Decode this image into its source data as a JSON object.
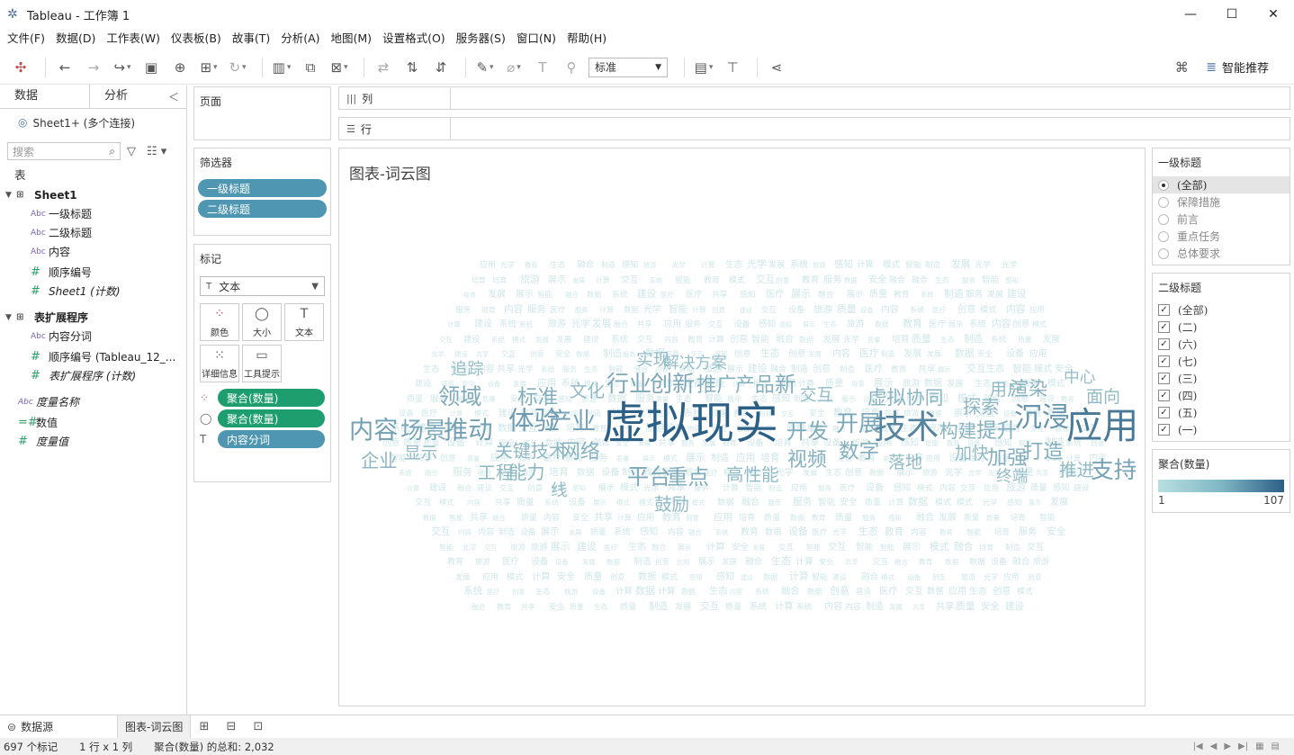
{
  "window": {
    "title": "Tableau - 工作簿 1",
    "min": "—",
    "max": "☐",
    "close": "✕"
  },
  "menus": [
    "文件(F)",
    "数据(D)",
    "工作表(W)",
    "仪表板(B)",
    "故事(T)",
    "分析(A)",
    "地图(M)",
    "设置格式(O)",
    "服务器(S)",
    "窗口(N)",
    "帮助(H)"
  ],
  "toolbar": {
    "fit_select": "标准",
    "smart_label": "智能推荐"
  },
  "left": {
    "tab_data": "数据",
    "tab_analysis": "分析",
    "datasource": "Sheet1+ (多个连接)",
    "search_placeholder": "搜索",
    "tables_header": "表",
    "sheet1": "Sheet1",
    "sheet1_fields": [
      {
        "type": "Abc",
        "name": "一级标题"
      },
      {
        "type": "Abc",
        "name": "二级标题"
      },
      {
        "type": "Abc",
        "name": "内容"
      },
      {
        "type": "#",
        "name": "顺序编号"
      },
      {
        "type": "#",
        "name": "Sheet1 (计数)"
      }
    ],
    "ext_table": "表扩展程序",
    "ext_fields": [
      {
        "type": "Abc",
        "name": "内容分词"
      },
      {
        "type": "#",
        "name": "顺序编号 (Tableau_12_..."
      },
      {
        "type": "#",
        "name": "表扩展程序 (计数)"
      }
    ],
    "measure_names": "度量名称",
    "measures": "数值",
    "measure_values": "度量值"
  },
  "shelves": {
    "pages": "页面",
    "filters": "筛选器",
    "filter_pills": [
      "一级标题",
      "二级标题"
    ],
    "marks": "标记",
    "mark_type": "文本",
    "mark_buttons": [
      "颜色",
      "大小",
      "文本",
      "详细信息",
      "工具提示"
    ],
    "encodings": [
      "聚合(数量)",
      "聚合(数量)",
      "内容分词"
    ],
    "columns": "列",
    "rows": "行"
  },
  "viz": {
    "title": "图表-词云图",
    "words": [
      {
        "t": "虚拟现实",
        "v": 107
      },
      {
        "t": "应用",
        "v": 78
      },
      {
        "t": "技术",
        "v": 66
      },
      {
        "t": "沉浸",
        "v": 50
      },
      {
        "t": "体验",
        "v": 44
      },
      {
        "t": "内容",
        "v": 40
      },
      {
        "t": "场景",
        "v": 36
      },
      {
        "t": "推动",
        "v": 40
      },
      {
        "t": "产业",
        "v": 38
      },
      {
        "t": "行业",
        "v": 34
      },
      {
        "t": "创新",
        "v": 34
      },
      {
        "t": "领域",
        "v": 32
      },
      {
        "t": "开展",
        "v": 34
      },
      {
        "t": "支持",
        "v": 36
      },
      {
        "t": "平台",
        "v": 32
      },
      {
        "t": "重点",
        "v": 30
      },
      {
        "t": "数字",
        "v": 28
      },
      {
        "t": "开发",
        "v": 30
      },
      {
        "t": "标准",
        "v": 28
      },
      {
        "t": "推广",
        "v": 27
      },
      {
        "t": "产品",
        "v": 26
      },
      {
        "t": "新",
        "v": 30
      },
      {
        "t": "提升",
        "v": 28
      },
      {
        "t": "打造",
        "v": 27
      },
      {
        "t": "加强",
        "v": 27
      },
      {
        "t": "网络",
        "v": 26
      },
      {
        "t": "视频",
        "v": 26
      },
      {
        "t": "虚拟",
        "v": 25
      },
      {
        "t": "渲染",
        "v": 24
      },
      {
        "t": "协同",
        "v": 23
      },
      {
        "t": "构建",
        "v": 23
      },
      {
        "t": "探索",
        "v": 22
      },
      {
        "t": "企业",
        "v": 22
      },
      {
        "t": "能力",
        "v": 22
      },
      {
        "t": "工程",
        "v": 21
      },
      {
        "t": "关键技术",
        "v": 21
      },
      {
        "t": "文化",
        "v": 20
      },
      {
        "t": "高性能",
        "v": 20
      },
      {
        "t": "鼓励",
        "v": 20
      },
      {
        "t": "用户",
        "v": 19
      },
      {
        "t": "面向",
        "v": 19
      },
      {
        "t": "推进",
        "v": 20
      },
      {
        "t": "加快",
        "v": 19
      },
      {
        "t": "落地",
        "v": 19
      },
      {
        "t": "显示",
        "v": 18
      },
      {
        "t": "实现",
        "v": 18
      },
      {
        "t": "解决方案",
        "v": 16
      },
      {
        "t": "交互",
        "v": 18
      },
      {
        "t": "追踪",
        "v": 17
      },
      {
        "t": "线",
        "v": 18
      },
      {
        "t": "中心",
        "v": 16
      },
      {
        "t": "终端",
        "v": 16
      }
    ]
  },
  "right": {
    "level1": "一级标题",
    "level1_opts": [
      "(全部)",
      "保障措施",
      "前言",
      "重点任务",
      "总体要求"
    ],
    "level2": "二级标题",
    "level2_opts": [
      "(全部)",
      "(二)",
      "(六)",
      "(七)",
      "(三)",
      "(四)",
      "(五)",
      "(一)"
    ],
    "legend_title": "聚合(数量)",
    "legend_min": "1",
    "legend_max": "107",
    "legend_colors": [
      "#b9dfe0",
      "#2c5f86"
    ]
  },
  "bottom": {
    "datasource_tab": "数据源",
    "sheet_tab": "图表-词云图",
    "status": [
      "697 个标记",
      "1 行 x 1 列",
      "聚合(数量) 的总和: 2,032"
    ]
  }
}
